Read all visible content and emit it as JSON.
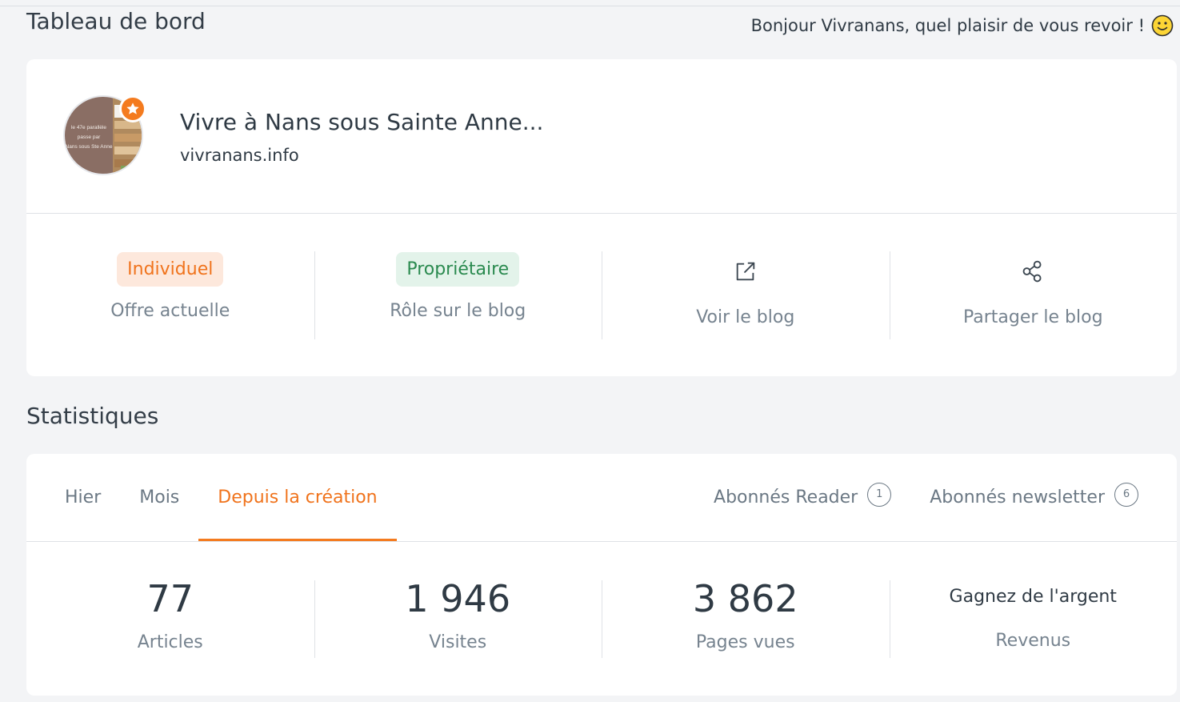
{
  "header": {
    "title": "Tableau de bord",
    "greeting": "Bonjour Vivranans, quel plaisir de vous revoir !"
  },
  "blog": {
    "name": "Vivre à Nans sous Sainte Anne...",
    "url": "vivranans.info",
    "avatar_text": [
      "le 47e parallèle",
      "passe par",
      "Nans sous Ste Anne"
    ],
    "plan": {
      "value": "Individuel",
      "label": "Offre actuelle"
    },
    "role": {
      "value": "Propriétaire",
      "label": "Rôle sur le blog"
    },
    "view_label": "Voir le blog",
    "share_label": "Partager le blog"
  },
  "stats": {
    "title": "Statistiques",
    "tabs": [
      "Hier",
      "Mois",
      "Depuis la création"
    ],
    "active_tab": "Depuis la création",
    "reader_label": "Abonnés Reader",
    "reader_count": "1",
    "newsletter_label": "Abonnés newsletter",
    "newsletter_count": "6",
    "articles": {
      "value": "77",
      "label": "Articles"
    },
    "visits": {
      "value": "1 946",
      "label": "Visites"
    },
    "pageviews": {
      "value": "3 862",
      "label": "Pages vues"
    },
    "revenue": {
      "text": "Gagnez de l'argent",
      "label": "Revenus"
    }
  },
  "colors": {
    "accent": "#f0731c",
    "success": "#2a8a4f",
    "muted": "#76838f",
    "background": "#f3f4f6"
  },
  "icons": {
    "view": "external-link-icon",
    "share": "share-icon",
    "badge": "star-icon",
    "greeting": "smiley-icon"
  }
}
